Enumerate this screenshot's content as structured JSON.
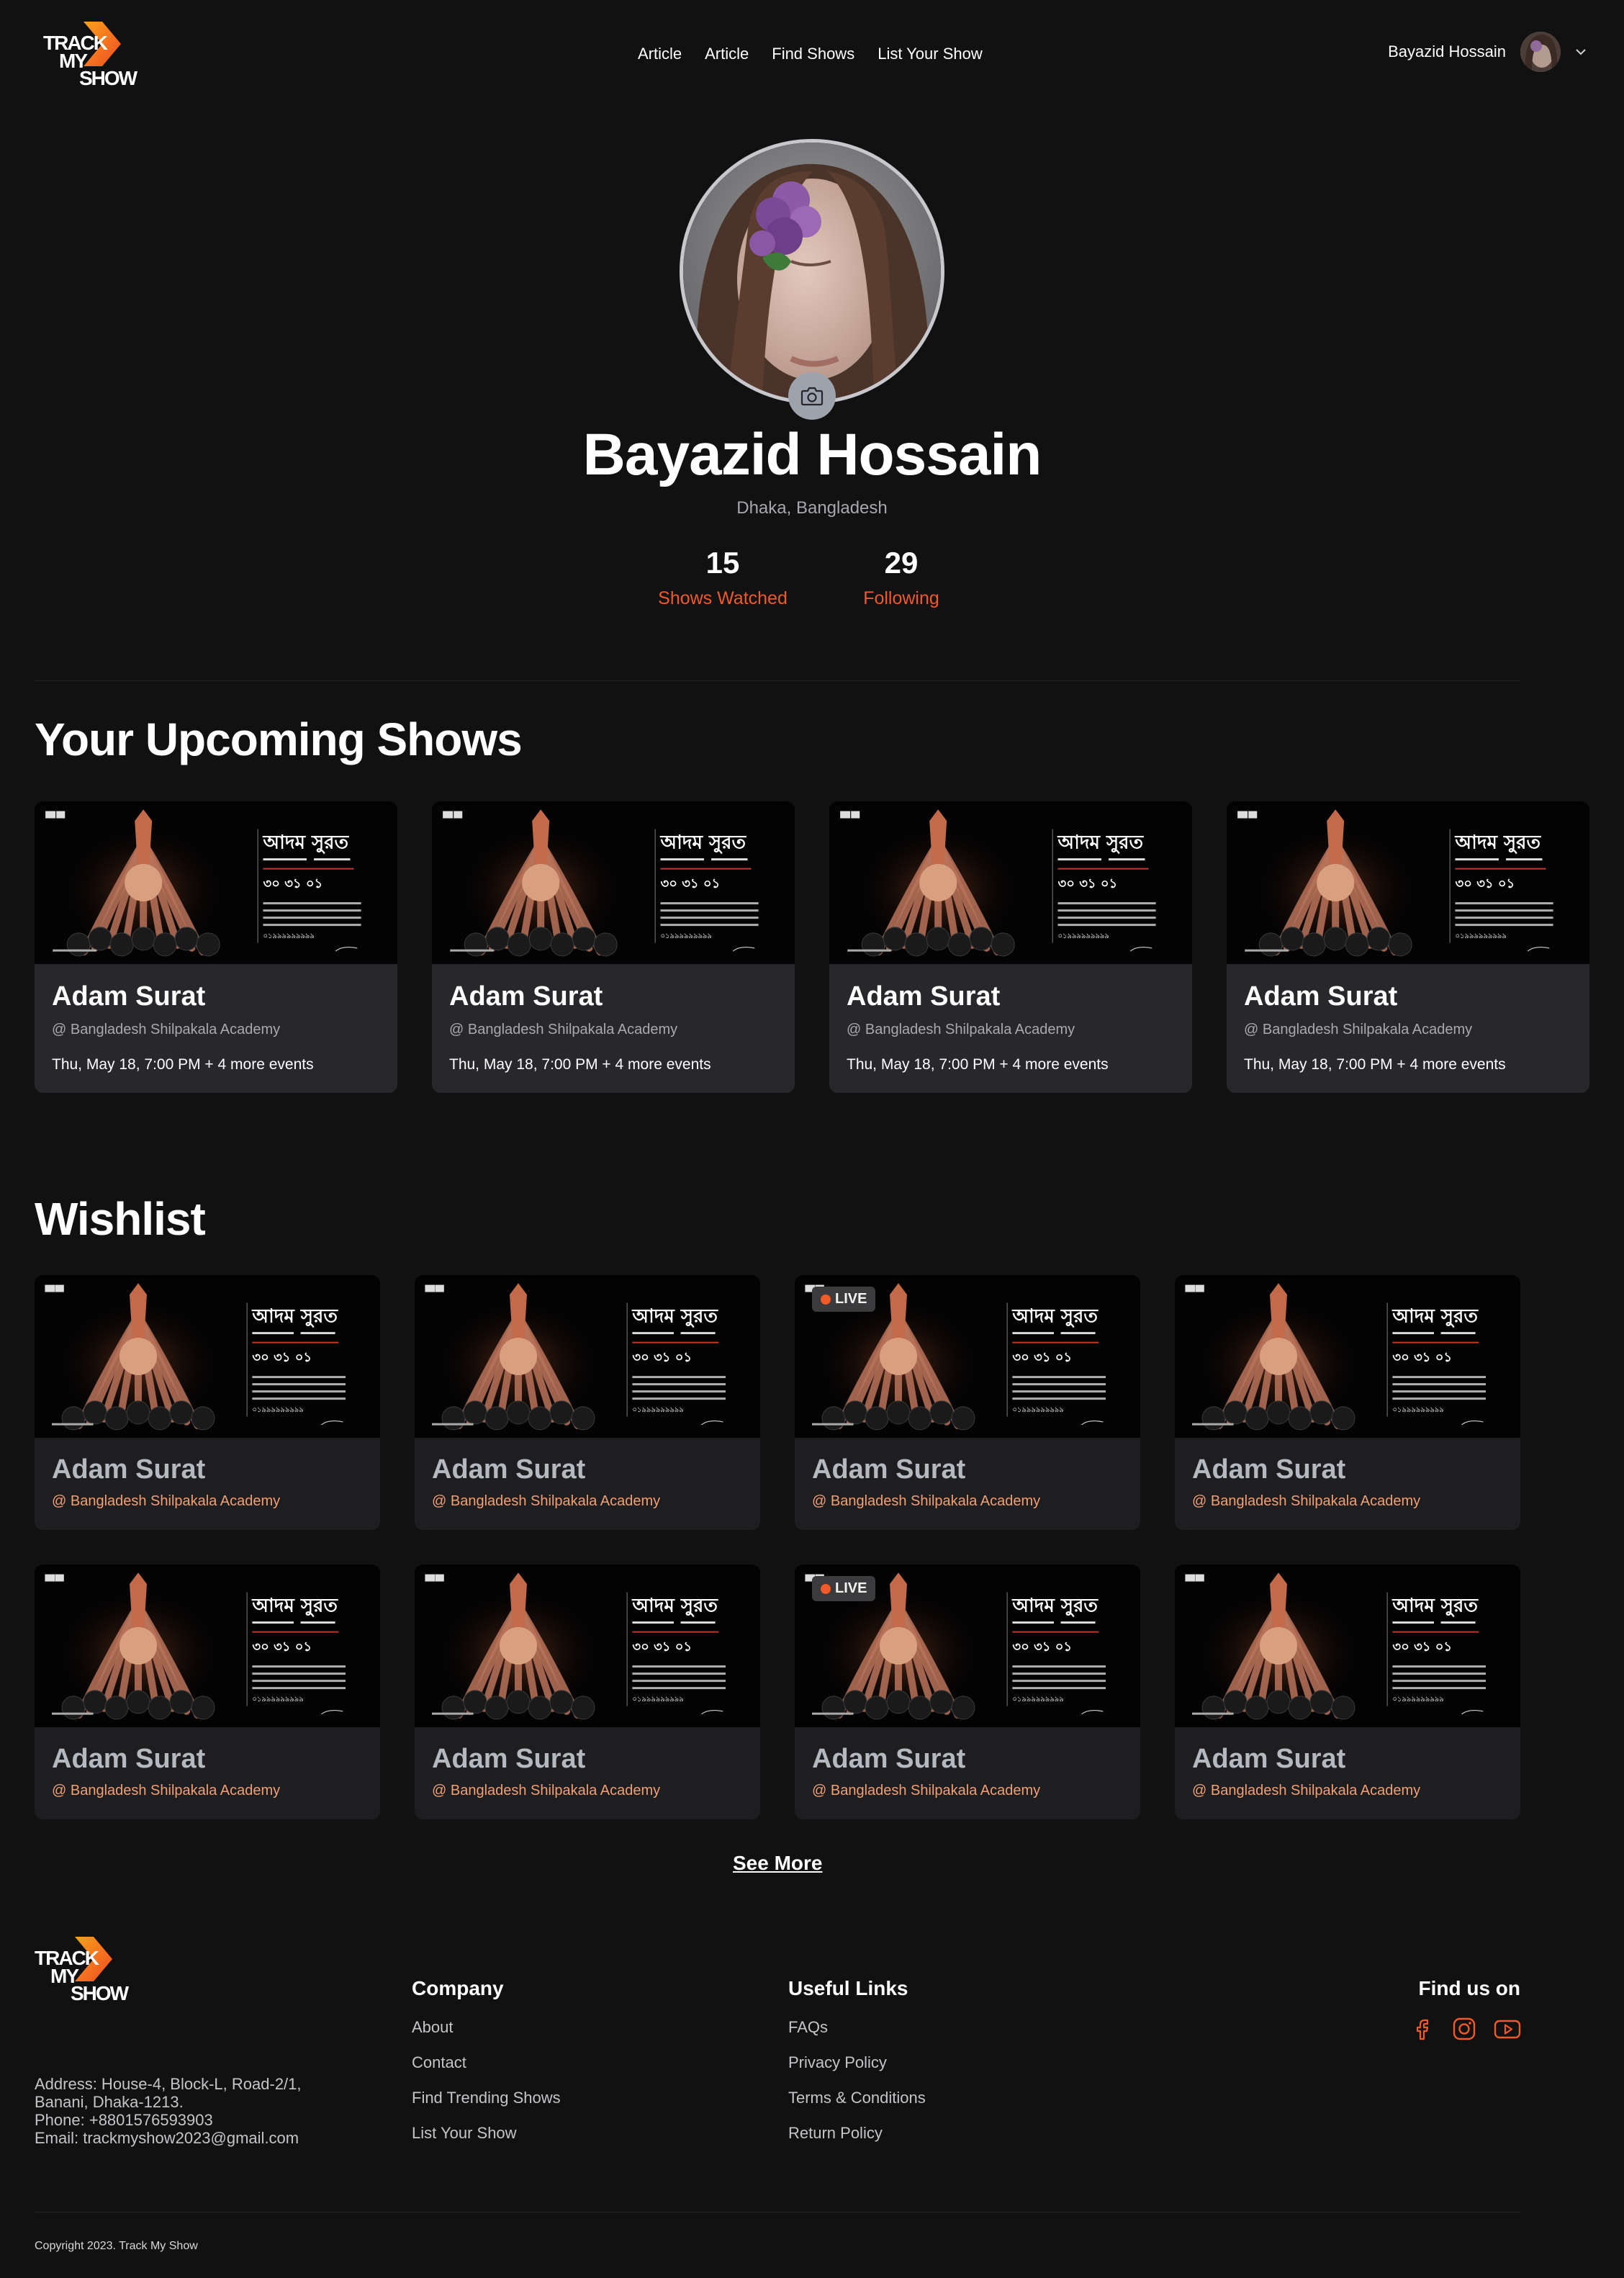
{
  "header": {
    "logo": {
      "line1": "TRACK",
      "line2": "MY",
      "line3": "SHOW"
    },
    "nav": [
      "Article",
      "Article",
      "Find Shows",
      "List Your Show"
    ],
    "user_name": "Bayazid Hossain"
  },
  "profile": {
    "name": "Bayazid Hossain",
    "location": "Dhaka, Bangladesh",
    "stats": [
      {
        "value": "15",
        "label": "Shows Watched"
      },
      {
        "value": "29",
        "label": "Following"
      }
    ]
  },
  "upcoming": {
    "title": "Your Upcoming Shows",
    "cards": [
      {
        "title": "Adam Surat",
        "venue": "@ Bangladesh Shilpakala Academy",
        "date": "Thu, May 18, 7:00 PM + 4 more events"
      },
      {
        "title": "Adam Surat",
        "venue": "@ Bangladesh Shilpakala Academy",
        "date": "Thu, May 18, 7:00 PM + 4 more events"
      },
      {
        "title": "Adam Surat",
        "venue": "@ Bangladesh Shilpakala Academy",
        "date": "Thu, May 18, 7:00 PM + 4 more events"
      },
      {
        "title": "Adam Surat",
        "venue": "@ Bangladesh Shilpakala Academy",
        "date": "Thu, May 18, 7:00 PM + 4 more events"
      }
    ]
  },
  "poster": {
    "bengali_title": "আদম সুরত",
    "live_label": "LIVE"
  },
  "wishlist": {
    "title": "Wishlist",
    "cards": [
      {
        "title": "Adam Surat",
        "venue": "@ Bangladesh Shilpakala Academy",
        "live": false
      },
      {
        "title": "Adam Surat",
        "venue": "@ Bangladesh Shilpakala Academy",
        "live": false
      },
      {
        "title": "Adam Surat",
        "venue": "@ Bangladesh Shilpakala Academy",
        "live": true
      },
      {
        "title": "Adam Surat",
        "venue": "@ Bangladesh Shilpakala Academy",
        "live": false
      },
      {
        "title": "Adam Surat",
        "venue": "@ Bangladesh Shilpakala Academy",
        "live": false
      },
      {
        "title": "Adam Surat",
        "venue": "@ Bangladesh Shilpakala Academy",
        "live": false
      },
      {
        "title": "Adam Surat",
        "venue": "@ Bangladesh Shilpakala Academy",
        "live": true
      },
      {
        "title": "Adam Surat",
        "venue": "@ Bangladesh Shilpakala Academy",
        "live": false
      }
    ],
    "see_more": "See More"
  },
  "footer": {
    "address_lines": [
      "Address: House-4, Block-L, Road-2/1,",
      "Banani, Dhaka-1213.",
      "Phone:  +8801576593903",
      "Email:  trackmyshow2023@gmail.com"
    ],
    "company": {
      "title": "Company",
      "links": [
        "About",
        "Contact",
        "Find Trending Shows",
        "List Your Show"
      ]
    },
    "useful": {
      "title": "Useful Links",
      "links": [
        "FAQs",
        "Privacy Policy",
        "Terms & Conditions",
        "Return Policy"
      ]
    },
    "social": {
      "title": "Find us on",
      "icons": [
        "facebook-icon",
        "instagram-icon",
        "youtube-icon"
      ]
    },
    "copyright": "Copyright 2023. Track My Show"
  },
  "colors": {
    "accent": "#f05a28",
    "background": "#121112",
    "card": "#28272b"
  }
}
